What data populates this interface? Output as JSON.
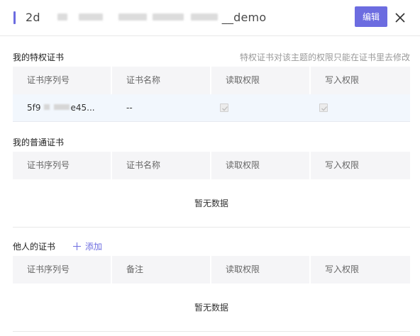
{
  "header": {
    "title_prefix": "2d",
    "title_suffix": "__demo",
    "edit_label": "编辑",
    "close_icon": "close-icon",
    "accent_color": "#6c6ce0"
  },
  "privileged": {
    "title": "我的特权证书",
    "hint": "特权证书对该主题的权限只能在证书里去修改",
    "columns": [
      "证书序列号",
      "证书名称",
      "读取权限",
      "写入权限"
    ],
    "row": {
      "serial_prefix": "5f9",
      "serial_suffix": "e45...",
      "name": "--",
      "read_checked": true,
      "write_checked": true
    }
  },
  "normal": {
    "title": "我的普通证书",
    "columns": [
      "证书序列号",
      "证书名称",
      "读取权限",
      "写入权限"
    ],
    "empty_text": "暂无数据"
  },
  "others": {
    "title": "他人的证书",
    "add_label": "添加",
    "columns": [
      "证书序列号",
      "备注",
      "读取权限",
      "写入权限"
    ],
    "empty_text": "暂无数据"
  }
}
